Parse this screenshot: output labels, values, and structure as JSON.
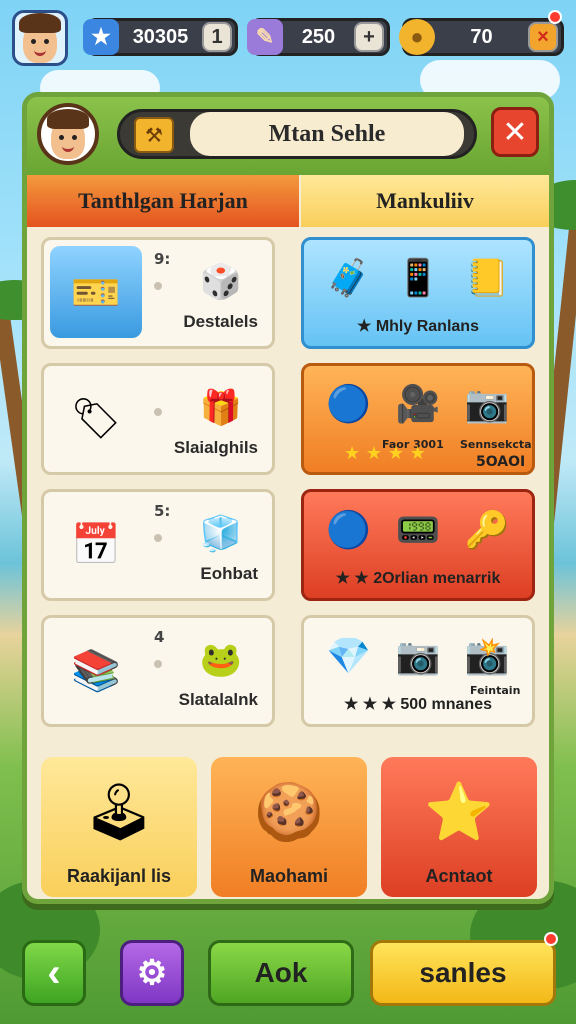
{
  "topbar": {
    "resources": [
      {
        "icon": "star-icon",
        "value": "30305",
        "button": "1"
      },
      {
        "icon": "feather-icon",
        "value": "250",
        "button": "+"
      },
      {
        "icon": "gold-coin-icon",
        "value": "70",
        "button": "×"
      }
    ]
  },
  "panel": {
    "title": "Mtan Sehle",
    "close_label": "✕",
    "tabs": [
      "Tanthlgan Harjan",
      "Mankuliiv"
    ]
  },
  "cards": [
    {
      "label": "Destalels",
      "num": "9:"
    },
    {
      "label": "Mhly Ranlans"
    },
    {
      "label": "Slaialghils"
    },
    {
      "mini1": "Faor 3001",
      "mini2": "Sennsekctan",
      "mini3": "5OAOI"
    },
    {
      "label": "Eohbat",
      "num": "5:"
    },
    {
      "label": "2Orlian menarrik"
    },
    {
      "label": "Slatalalnk",
      "num": "4"
    },
    {
      "label": "500 mnanes",
      "mini": "Feintain"
    }
  ],
  "bottom_cards": [
    {
      "label": "Raakijanl lis"
    },
    {
      "label": "Maohami"
    },
    {
      "label": "Acntaot"
    }
  ],
  "bottom_buttons": {
    "back": "‹",
    "settings": "⚙",
    "ok": "Aok",
    "sales": "sanles"
  }
}
